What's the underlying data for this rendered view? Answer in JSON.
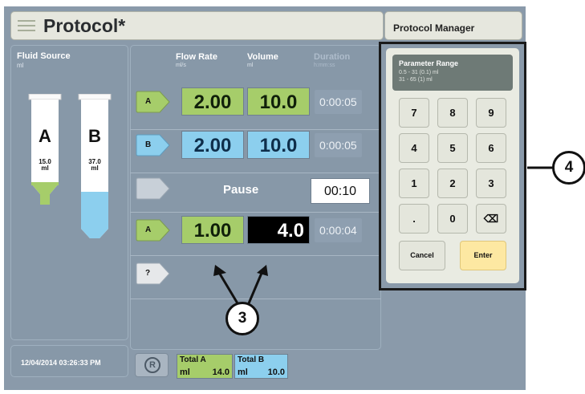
{
  "title_bar": {
    "title": "Protocol*"
  },
  "protocol_manager_label": "Protocol Manager",
  "fluid_source": {
    "header": "Fluid Source",
    "unit": "ml",
    "tubes": [
      {
        "letter": "A",
        "volume": "15.0",
        "unit": "ml",
        "color": "#a6cd6a"
      },
      {
        "letter": "B",
        "volume": "37.0",
        "unit": "ml",
        "color": "#8ccfee"
      }
    ]
  },
  "timestamp": "12/04/2014 03:26:33 PM",
  "columns": {
    "flow_rate": "Flow Rate",
    "flow_rate_unit": "ml/s",
    "volume": "Volume",
    "volume_unit": "ml",
    "duration": "Duration",
    "duration_unit": "h:mm:ss"
  },
  "steps": [
    {
      "source": "A",
      "flow_rate": "2.00",
      "volume": "10.0",
      "duration": "0:00:05"
    },
    {
      "source": "B",
      "flow_rate": "2.00",
      "volume": "10.0",
      "duration": "0:00:05"
    },
    {
      "label": "Pause",
      "time": "00:10"
    },
    {
      "source": "A",
      "flow_rate": "1.00",
      "volume": "4.0",
      "duration": "0:00:04"
    },
    {
      "source": "?"
    }
  ],
  "totals": {
    "reset_label": "R",
    "a": {
      "label": "Total A",
      "unit": "ml",
      "value": "14.0"
    },
    "b": {
      "label": "Total B",
      "unit": "ml",
      "value": "10.0"
    }
  },
  "keypad": {
    "range_title": "Parameter Range",
    "range_lines": [
      "0.5 - 31 (0.1) ml",
      "31 - 65 (1) ml"
    ],
    "keys": [
      "7",
      "8",
      "9",
      "4",
      "5",
      "6",
      "1",
      "2",
      "3",
      ".",
      "0",
      "⌫"
    ],
    "cancel": "Cancel",
    "enter": "Enter"
  },
  "callouts": {
    "steps_callout": "3",
    "keypad_callout": "4"
  },
  "colors": {
    "source_a": "#a6cd6a",
    "source_b": "#8ccfee",
    "panel": "#8798a8",
    "enter_key": "#fde8a2"
  }
}
